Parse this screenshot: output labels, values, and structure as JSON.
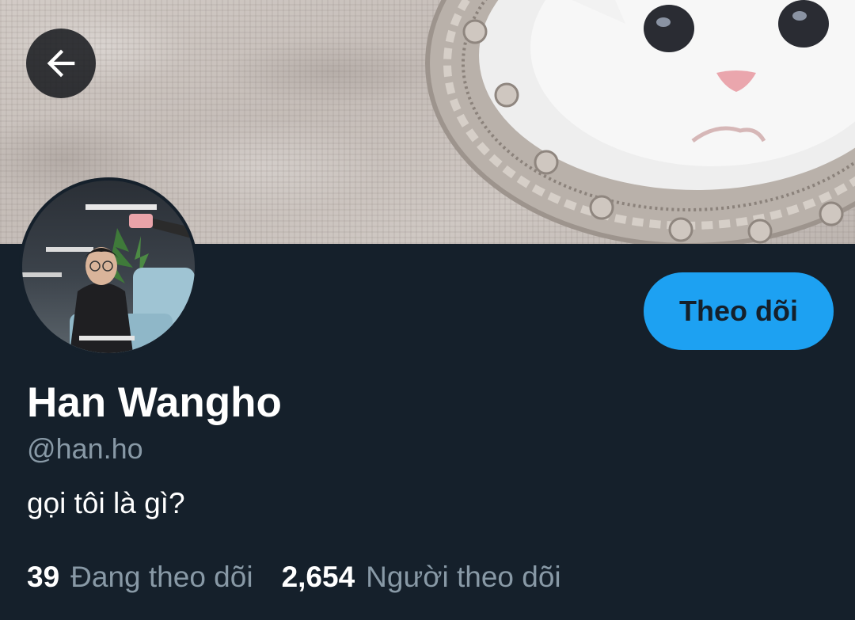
{
  "profile": {
    "display_name": "Han Wangho",
    "handle": "@han.ho",
    "bio": "gọi tôi là gì?"
  },
  "actions": {
    "follow_label": "Theo dõi"
  },
  "stats": {
    "following_count": "39",
    "following_label": "Đang theo dõi",
    "followers_count": "2,654",
    "followers_label": "Người theo dõi"
  },
  "icons": {
    "back": "arrow-left-icon"
  },
  "colors": {
    "background": "#15202b",
    "accent": "#1da1f2",
    "secondary_text": "#8899a6"
  }
}
